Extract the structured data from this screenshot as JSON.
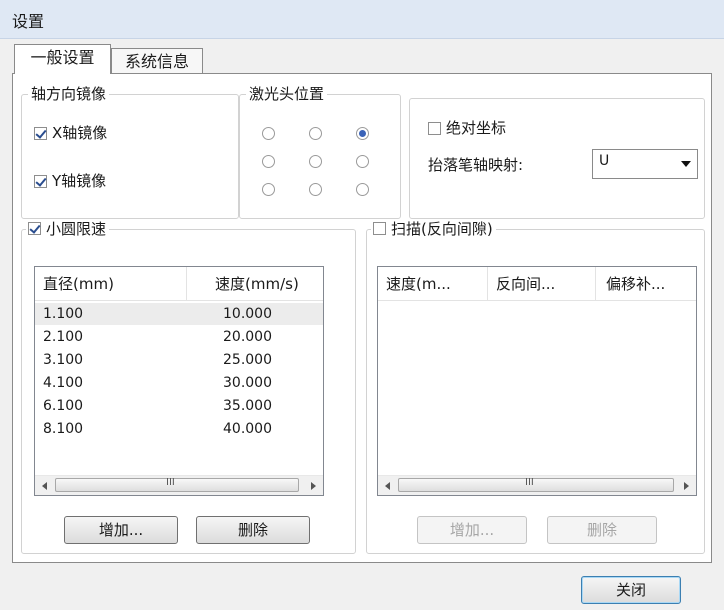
{
  "window": {
    "title": "设置"
  },
  "tabs": [
    {
      "label": "一般设置",
      "active": true
    },
    {
      "label": "系统信息",
      "active": false
    }
  ],
  "axis_mirror": {
    "title": "轴方向镜像",
    "x_label": "X轴镜像",
    "x_checked": true,
    "y_label": "Y轴镜像",
    "y_checked": true
  },
  "laser_position": {
    "title": "激光头位置",
    "selected_index": 2
  },
  "coords": {
    "absolute_label": "绝对坐标",
    "absolute_checked": false,
    "pen_axis_label": "抬落笔轴映射:",
    "pen_axis_value": "U"
  },
  "small_circle": {
    "label": "小圆限速",
    "checked": true,
    "columns": [
      "直径(mm)",
      "速度(mm/s)"
    ],
    "rows": [
      [
        "1.100",
        "10.000"
      ],
      [
        "2.100",
        "20.000"
      ],
      [
        "3.100",
        "25.000"
      ],
      [
        "4.100",
        "30.000"
      ],
      [
        "6.100",
        "35.000"
      ],
      [
        "8.100",
        "40.000"
      ]
    ],
    "add_label": "增加...",
    "delete_label": "删除"
  },
  "scan": {
    "label": "扫描(反向间隙)",
    "checked": false,
    "columns": [
      "速度(m...",
      "反向间...",
      "偏移补..."
    ],
    "add_label": "增加...",
    "delete_label": "删除"
  },
  "footer": {
    "close_label": "关闭"
  },
  "scroll_grip": "III"
}
